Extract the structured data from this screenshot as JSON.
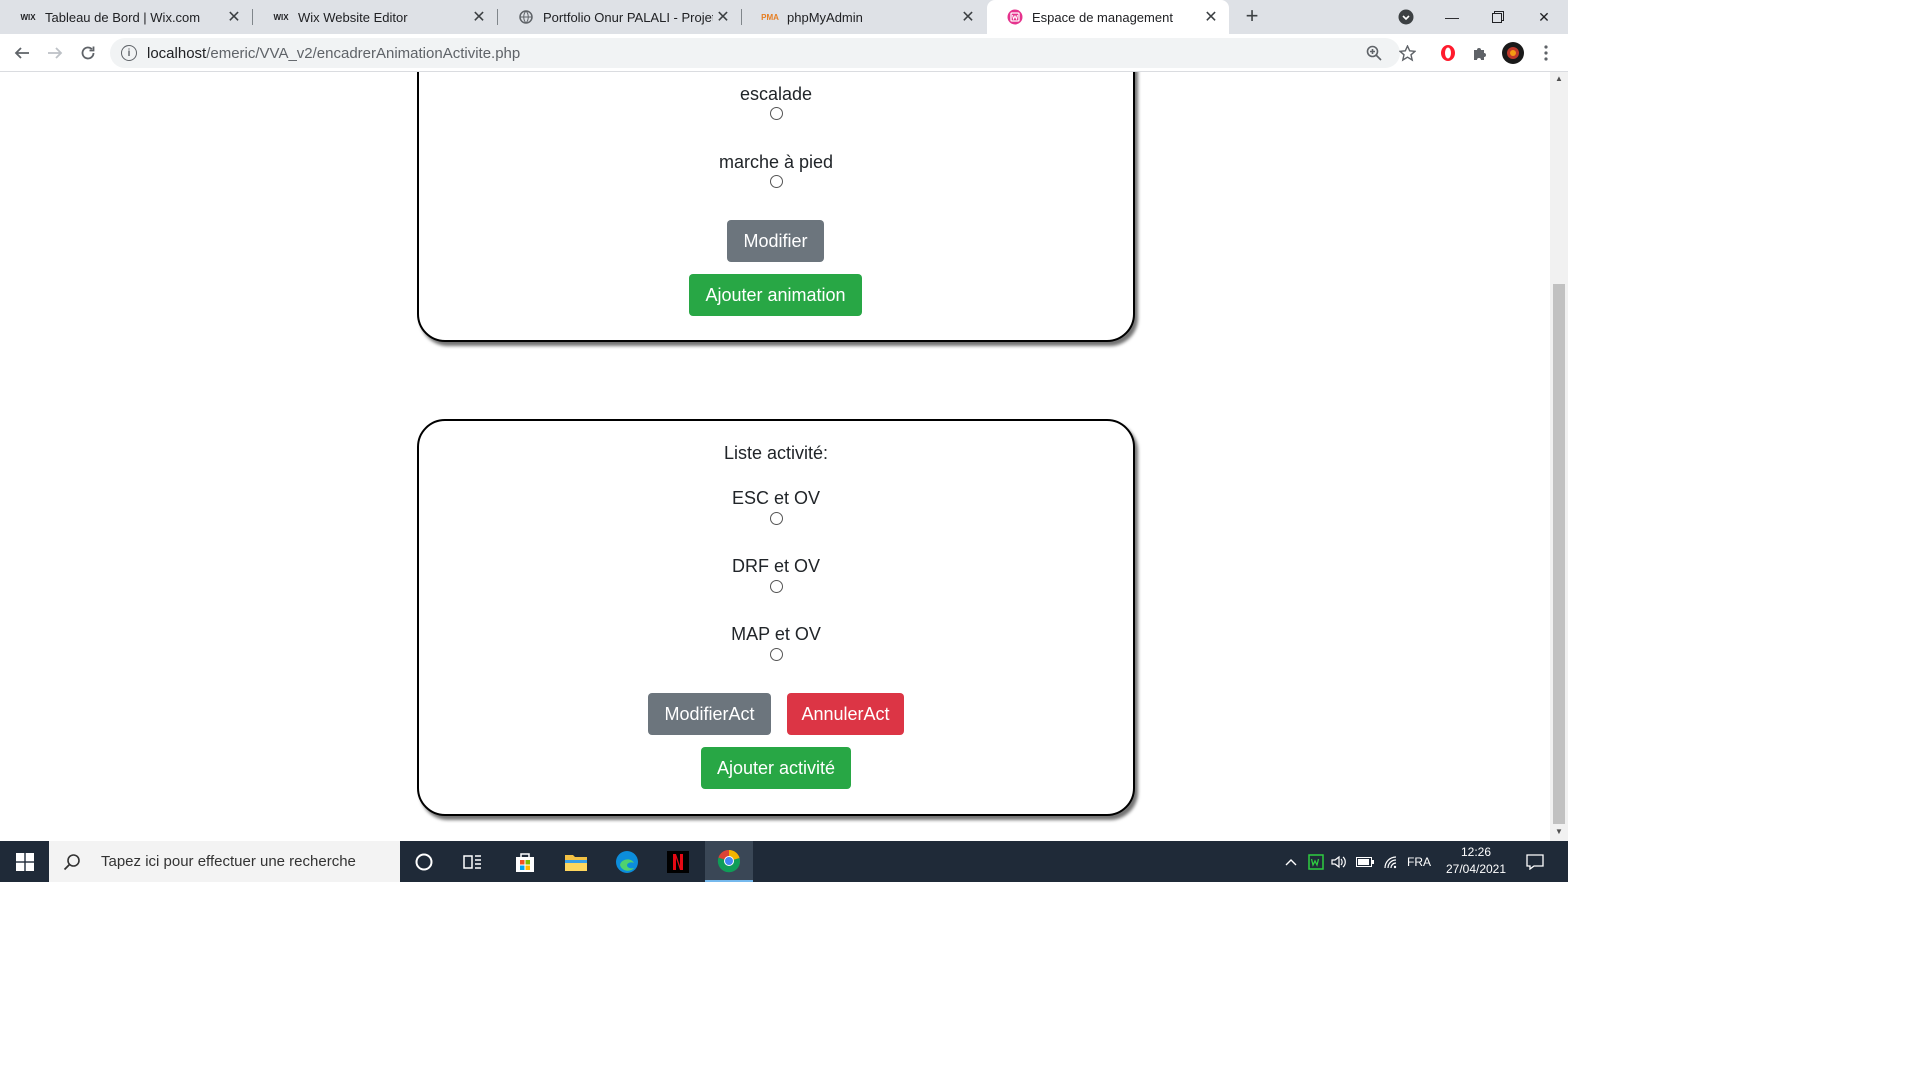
{
  "browser": {
    "tabs": [
      {
        "title": "Tableau de Bord | Wix.com",
        "favicon": "wix-icon",
        "active": false
      },
      {
        "title": "Wix Website Editor",
        "favicon": "wix-icon",
        "active": false
      },
      {
        "title": "Portfolio Onur PALALI - Projets",
        "favicon": "globe-icon",
        "active": false
      },
      {
        "title": "phpMyAdmin",
        "favicon": "phpmyadmin-icon",
        "active": false
      },
      {
        "title": "Espace de management",
        "favicon": "wamp-icon",
        "active": true
      }
    ],
    "favicon_text": {
      "wix": "WIX",
      "pma": "PMA"
    },
    "url_host": "localhost",
    "url_path": "/emeric/VVA_v2/encadrerAnimationActivite.php"
  },
  "animation_card": {
    "items": [
      {
        "label": "escalade"
      },
      {
        "label": "marche à pied"
      }
    ],
    "modify_label": "Modifier",
    "add_label": "Ajouter animation"
  },
  "activity_card": {
    "title": "Liste activité:",
    "items": [
      {
        "label": "ESC et OV"
      },
      {
        "label": "DRF et OV"
      },
      {
        "label": "MAP et OV"
      }
    ],
    "modify_label": "ModifierAct",
    "cancel_label": "AnnulerAct",
    "add_label": "Ajouter activité"
  },
  "taskbar": {
    "search_placeholder": "Tapez ici pour effectuer une recherche",
    "language": "FRA",
    "time": "12:26",
    "date": "27/04/2021"
  },
  "colors": {
    "grey_button": "#6c757d",
    "green_button": "#28a745",
    "red_button": "#dc3545"
  }
}
